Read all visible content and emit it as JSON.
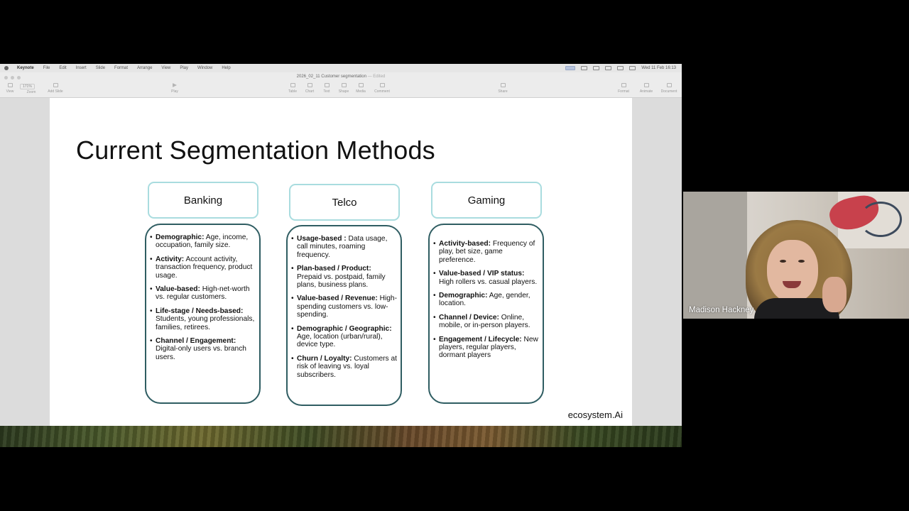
{
  "menubar": {
    "app_name": "Keynote",
    "items": [
      "File",
      "Edit",
      "Insert",
      "Slide",
      "Format",
      "Arrange",
      "View",
      "Play",
      "Window",
      "Help"
    ],
    "clock": "Wed 11 Feb  16:13"
  },
  "window": {
    "doc_title": "2026_02_11 Customer segmentation",
    "edited_label": "— Edited",
    "zoom_value": "171%",
    "toolbar": {
      "view": "View",
      "zoom": "Zoom",
      "add_slide": "Add Slide",
      "play": "Play",
      "table": "Table",
      "chart": "Chart",
      "text": "Text",
      "shape": "Shape",
      "media": "Media",
      "comment": "Comment",
      "share": "Share",
      "format": "Format",
      "animate": "Animate",
      "document": "Document"
    }
  },
  "slide": {
    "title": "Current Segmentation Methods",
    "brand": "ecosystem.Ai",
    "columns": [
      {
        "header": "Banking",
        "items": [
          {
            "label": "Demographic:",
            "text": " Age, income, occupation, family size."
          },
          {
            "label": "Activity:",
            "text": " Account activity, transaction frequency, product usage."
          },
          {
            "label": "Value-based:",
            "text": " High-net-worth vs. regular customers."
          },
          {
            "label": "Life-stage / Needs-based:",
            "text": " Students, young professionals, families, retirees."
          },
          {
            "label": "Channel / Engagement:",
            "text": " Digital-only users vs. branch users."
          }
        ]
      },
      {
        "header": "Telco",
        "items": [
          {
            "label": "Usage-based :",
            "text": " Data usage, call minutes, roaming frequency."
          },
          {
            "label": "Plan-based / Product:",
            "text": " Prepaid vs. postpaid, family plans, business plans."
          },
          {
            "label": "Value-based / Revenue:",
            "text": " High-spending customers vs. low-spending."
          },
          {
            "label": "Demographic / Geographic:",
            "text": " Age, location (urban/rural), device type."
          },
          {
            "label": "Churn / Loyalty:",
            "text": " Customers at risk of leaving vs. loyal subscribers."
          }
        ]
      },
      {
        "header": "Gaming",
        "items": [
          {
            "label": "Activity-based:",
            "text": " Frequency of play, bet size, game preference."
          },
          {
            "label": "Value-based / VIP status:",
            "text": " High rollers vs. casual players."
          },
          {
            "label": "Demographic:",
            "text": " Age, gender, location."
          },
          {
            "label": "Channel / Device:",
            "text": " Online, mobile, or in-person players."
          },
          {
            "label": "Engagement / Lifecycle:",
            "text": " New players, regular players, dormant players"
          }
        ]
      }
    ]
  },
  "participant": {
    "name": "Madison Hackney"
  }
}
